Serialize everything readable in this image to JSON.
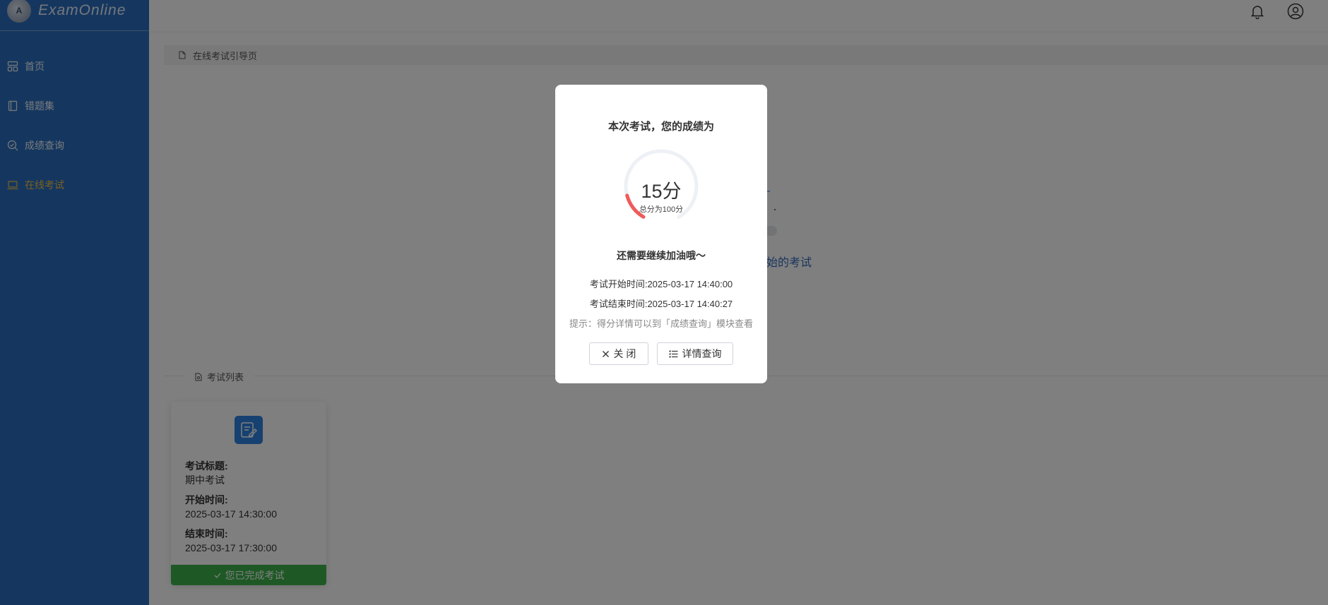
{
  "app": {
    "title": "ExamOnline",
    "logo_glyph": "A"
  },
  "sidebar": {
    "items": [
      {
        "label": "首页",
        "icon": "dashboard-icon"
      },
      {
        "label": "错题集",
        "icon": "book-icon"
      },
      {
        "label": "成绩查询",
        "icon": "search-icon"
      },
      {
        "label": "在线考试",
        "icon": "laptop-icon",
        "active": true
      }
    ]
  },
  "header": {
    "icons": [
      "bell-icon",
      "user-circle-icon"
    ]
  },
  "breadcrumb": {
    "label": "在线考试引导页"
  },
  "background_hint": {
    "text": "始的考试"
  },
  "exam_list": {
    "title": "考试列表",
    "cards": [
      {
        "title_label": "考试标题:",
        "title": "期中考试",
        "start_label": "开始时间:",
        "start_time": "2025-03-17 14:30:00",
        "end_label": "结束时间:",
        "end_time": "2025-03-17 17:30:00",
        "status": "您已完成考试"
      }
    ]
  },
  "result_dialog": {
    "title": "本次考试，您的成绩为",
    "score_text": "15分",
    "score": 15,
    "total": 100,
    "total_text": "总分为100分",
    "encourage": "还需要继续加油哦～",
    "start_label": "考试开始时间:",
    "start_time": "2025-03-17 14:40:00",
    "end_label": "考试结束时间:",
    "end_time": "2025-03-17 14:40:27",
    "tip": "提示：得分详情可以到「成绩查询」模块查看",
    "close_label": "关 闭",
    "detail_label": "详情查询"
  },
  "colors": {
    "sidebar_bg": "#2a6fbf",
    "active": "#f6c144",
    "gauge_progress": "#f05a5a",
    "success": "#3cb34a"
  }
}
